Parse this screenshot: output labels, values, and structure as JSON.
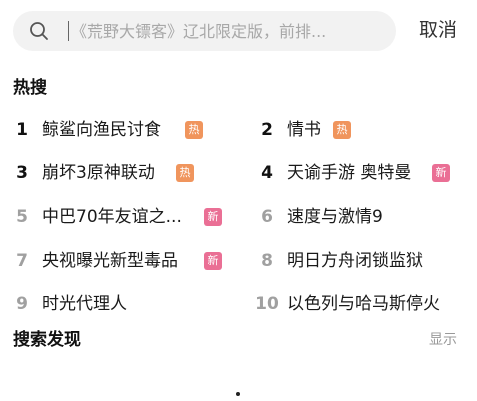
{
  "search": {
    "placeholder": "《荒野大镖客》辽北限定版，前排...",
    "cancel_label": "取消"
  },
  "hot": {
    "title": "热搜",
    "items": [
      {
        "rank": "1",
        "text": "鲸鲨向渔民讨食",
        "badge": "热",
        "badge_type": "hot"
      },
      {
        "rank": "2",
        "text": "情书",
        "badge": "热",
        "badge_type": "hot"
      },
      {
        "rank": "3",
        "text": "崩坏3原神联动",
        "badge": "热",
        "badge_type": "hot"
      },
      {
        "rank": "4",
        "text": "天谕手游 奥特曼",
        "badge": "新",
        "badge_type": "new"
      },
      {
        "rank": "5",
        "text": "中巴70年友谊之...",
        "badge": "新",
        "badge_type": "new"
      },
      {
        "rank": "6",
        "text": "速度与激情9",
        "badge": "",
        "badge_type": ""
      },
      {
        "rank": "7",
        "text": "央视曝光新型毒品",
        "badge": "新",
        "badge_type": "new"
      },
      {
        "rank": "8",
        "text": "明日方舟闭锁监狱",
        "badge": "",
        "badge_type": ""
      },
      {
        "rank": "9",
        "text": "时光代理人",
        "badge": "",
        "badge_type": ""
      },
      {
        "rank": "10",
        "text": "以色列与哈马斯停火",
        "badge": "",
        "badge_type": ""
      }
    ]
  },
  "discover": {
    "title": "搜索发现",
    "toggle_label": "显示"
  },
  "colors": {
    "hot_badge": "#f0955d",
    "new_badge": "#ea6f95",
    "search_bg": "#f2f2f2"
  }
}
